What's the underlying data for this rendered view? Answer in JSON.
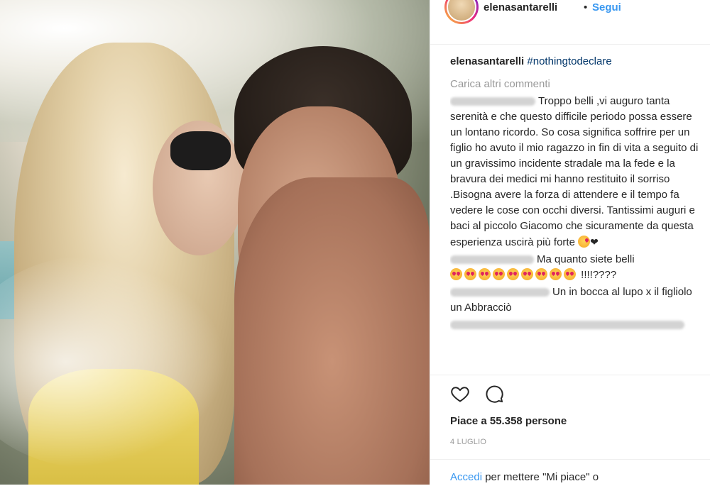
{
  "header": {
    "username": "elenasantarelli",
    "separator": "•",
    "follow_label": "Segui"
  },
  "caption": {
    "username": "elenasantarelli",
    "hashtag": "#nothingtodeclare"
  },
  "load_more": "Carica altri commenti",
  "comments": [
    {
      "text": "Troppo belli ,vi auguro tanta serenità e che questo difficile periodo possa essere un lontano ricordo. So cosa significa soffrire per un figlio ho avuto il mio ragazzo in fin di vita a seguito di un gravissimo incidente stradale ma la fede e la bravura dei medici mi hanno restituito il sorriso .Bisogna avere la forza di attendere e il tempo fa vedere le cose con occhi diversi. Tantissimi auguri e baci al piccolo Giacomo che sicuramente da questa esperienza uscirà più forte",
      "trailing": "❤"
    },
    {
      "text": "Ma quanto siete belli",
      "trailing": "!!!!????"
    },
    {
      "text": "Un in bocca al lupo x il figliolo un Abbracciò"
    }
  ],
  "actions": {
    "like_icon": "heart-outline-icon",
    "comment_icon": "speech-bubble-icon"
  },
  "likes_text": "Piace a 55.358 persone",
  "date_text": "4 LUGLIO",
  "login": {
    "link_label": "Accedi",
    "rest": " per mettere \"Mi piace\" o"
  },
  "colors": {
    "link": "#3897f0",
    "hashtag": "#003569",
    "muted": "#999999",
    "text": "#262626"
  }
}
